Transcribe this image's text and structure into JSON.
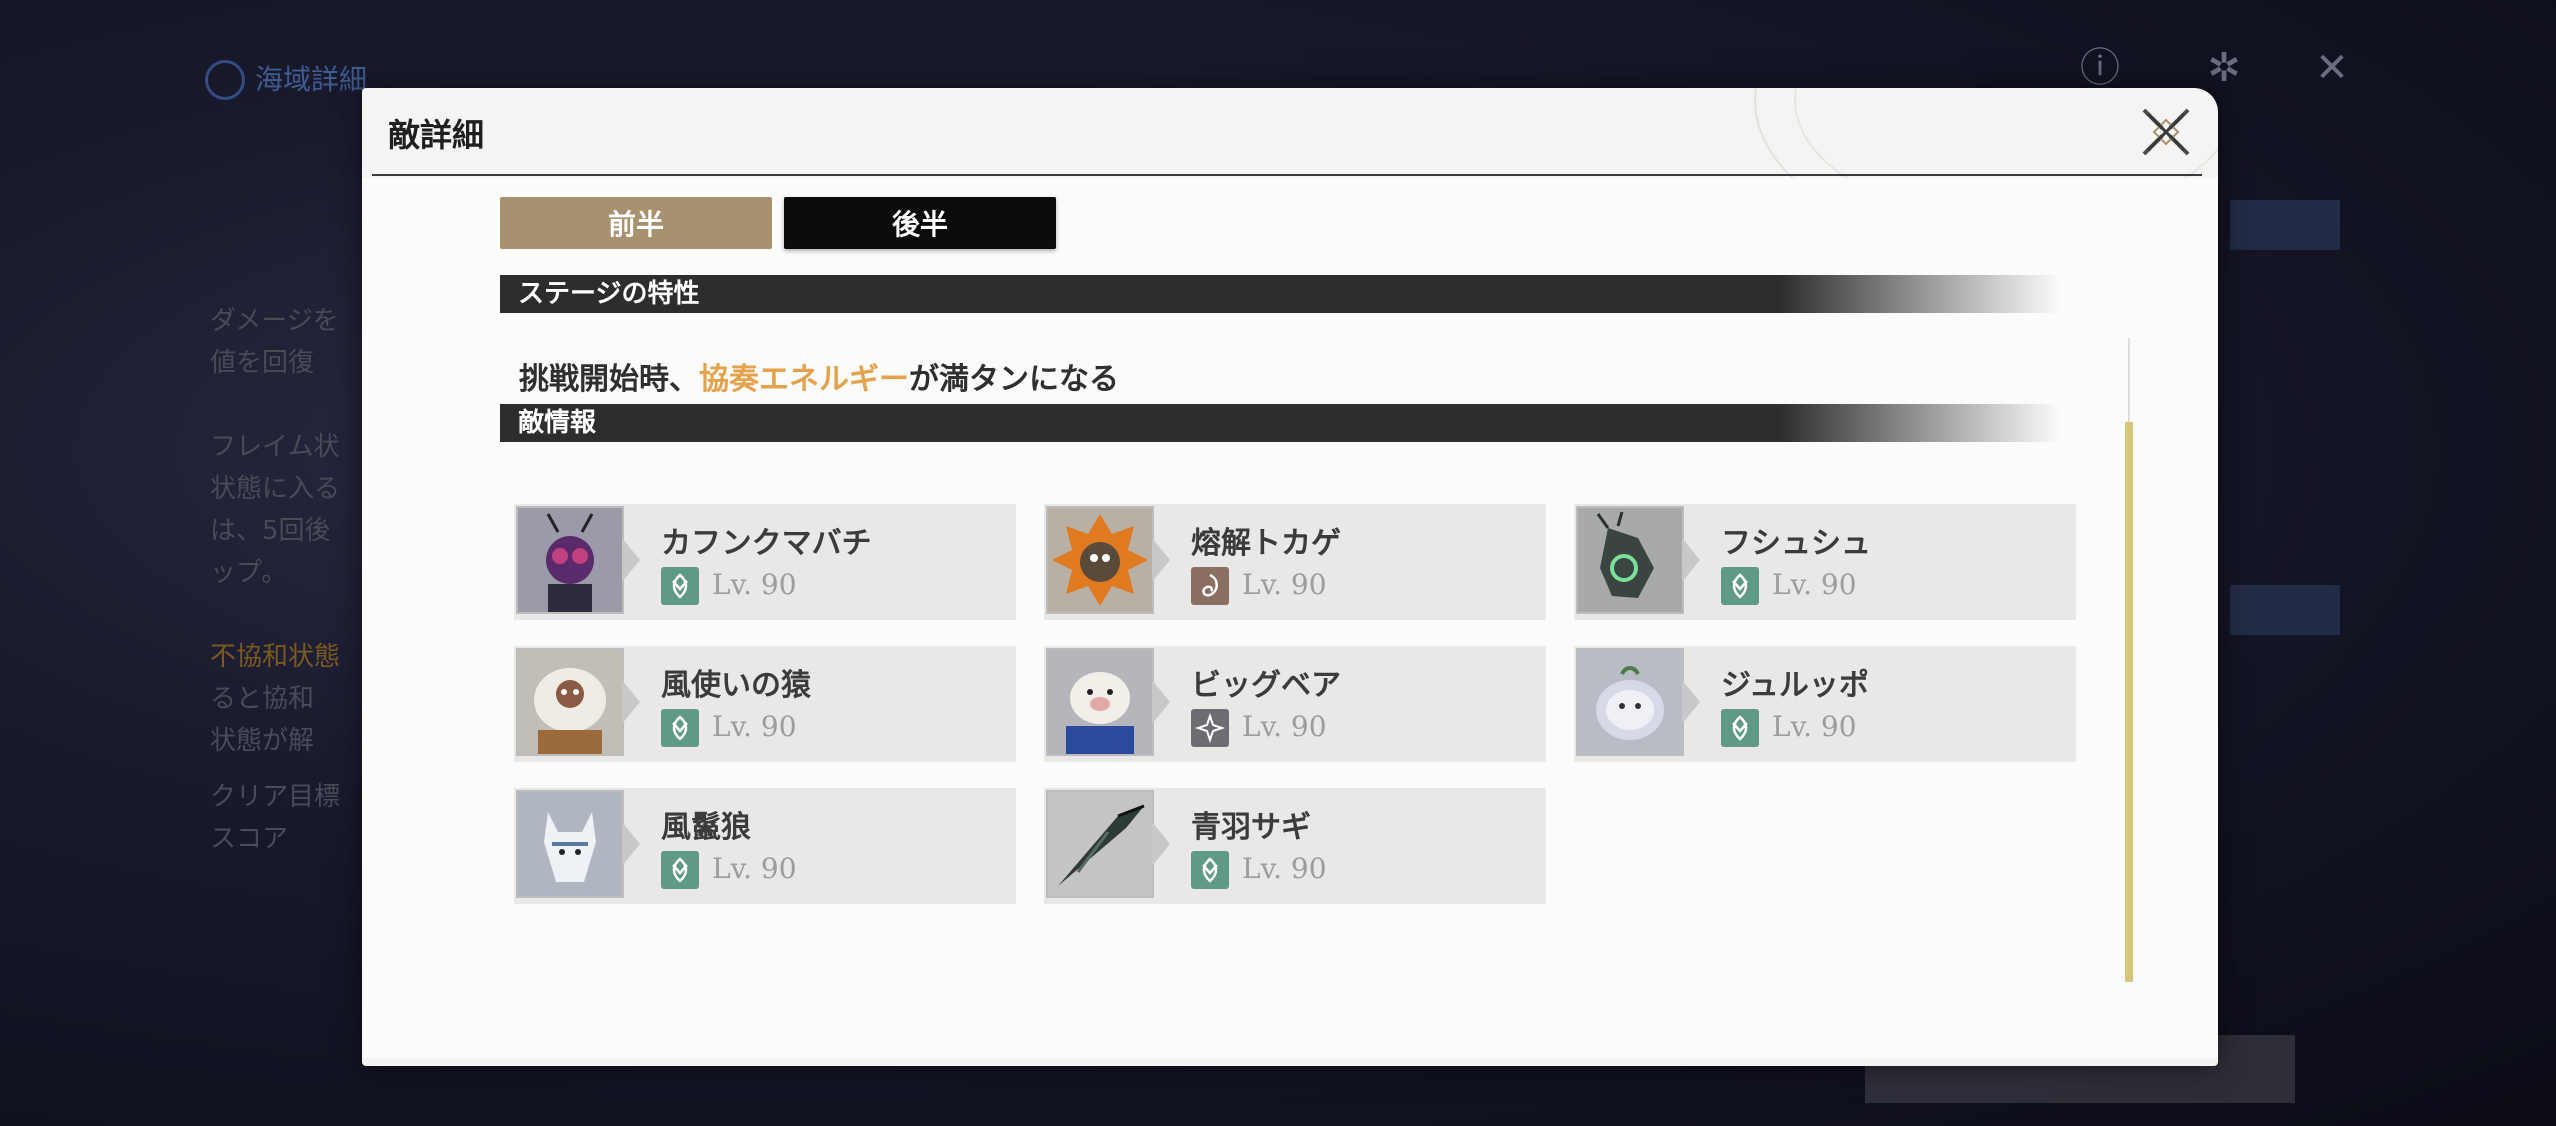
{
  "background": {
    "title": "海域詳細",
    "side_lines": [
      "ダメージを",
      "値を回復",
      "",
      "フレイム状",
      "状態に入る",
      "は、5回後",
      "ップ。",
      "",
      "不協和状態",
      "ると協和",
      "状態が解"
    ],
    "clear_title": "クリア目標",
    "score_label": "スコア"
  },
  "modal": {
    "title": "敵詳細",
    "close_icon": "close-x-icon"
  },
  "tabs": [
    {
      "label": "前半",
      "active": true
    },
    {
      "label": "後半",
      "active": false
    }
  ],
  "stage_section": {
    "header": "ステージの特性",
    "desc_before": "挑戦開始時、",
    "desc_highlight": "協奏エネルギー",
    "desc_after": "が満タンになる"
  },
  "enemy_section": {
    "header": "敵情報"
  },
  "enemies": [
    {
      "name": "カフンクマバチ",
      "level": "Lv. 90",
      "attr": "aero",
      "attr_color": "#5f9a86"
    },
    {
      "name": "熔解トカゲ",
      "level": "Lv. 90",
      "attr": "fusion",
      "attr_color": "#8a6e62"
    },
    {
      "name": "フシュシュ",
      "level": "Lv. 90",
      "attr": "aero",
      "attr_color": "#5f9a86"
    },
    {
      "name": "風使いの猿",
      "level": "Lv. 90",
      "attr": "aero",
      "attr_color": "#5f9a86"
    },
    {
      "name": "ビッグベア",
      "level": "Lv. 90",
      "attr": "havoc",
      "attr_color": "#6c6c72"
    },
    {
      "name": "ジュルッポ",
      "level": "Lv. 90",
      "attr": "aero",
      "attr_color": "#5f9a86"
    },
    {
      "name": "風鬣狼",
      "level": "Lv. 90",
      "attr": "aero",
      "attr_color": "#5f9a86"
    },
    {
      "name": "青羽サギ",
      "level": "Lv. 90",
      "attr": "aero",
      "attr_color": "#5f9a86"
    }
  ],
  "colors": {
    "accent_gold": "#a8916f",
    "highlight_orange": "#e3a24b",
    "scrollbar": "#d4c67e"
  }
}
